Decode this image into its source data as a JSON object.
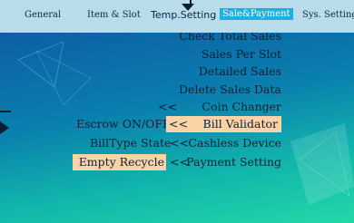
{
  "tabs": [
    {
      "label": "General"
    },
    {
      "label": "Item & Slot"
    },
    {
      "label": "Temp.Setting"
    },
    {
      "label": "Sale&Payment"
    },
    {
      "label": "Sys. Setting"
    }
  ],
  "menu": {
    "check_total_sales": "Check Total Sales",
    "sales_per_slot": "Sales Per Slot",
    "detailed_sales": "Detailed Sales",
    "delete_sales_data": "Delete Sales Data",
    "coin_changer": "Coin Changer",
    "bill_validator": "Bill Validator",
    "cashless_device": "Cashless Device",
    "payment_setting": "Payment Setting"
  },
  "submenu": {
    "escrow": "Escrow ON/OFF",
    "billtype_state": "BillType State",
    "empty_recycle": "Empty Recycle"
  },
  "arrow_symbol": "<<",
  "colors": {
    "highlight": "#fcd3a6",
    "active_tab": "#1fb0dd",
    "tabbar": "#b8dcea"
  }
}
